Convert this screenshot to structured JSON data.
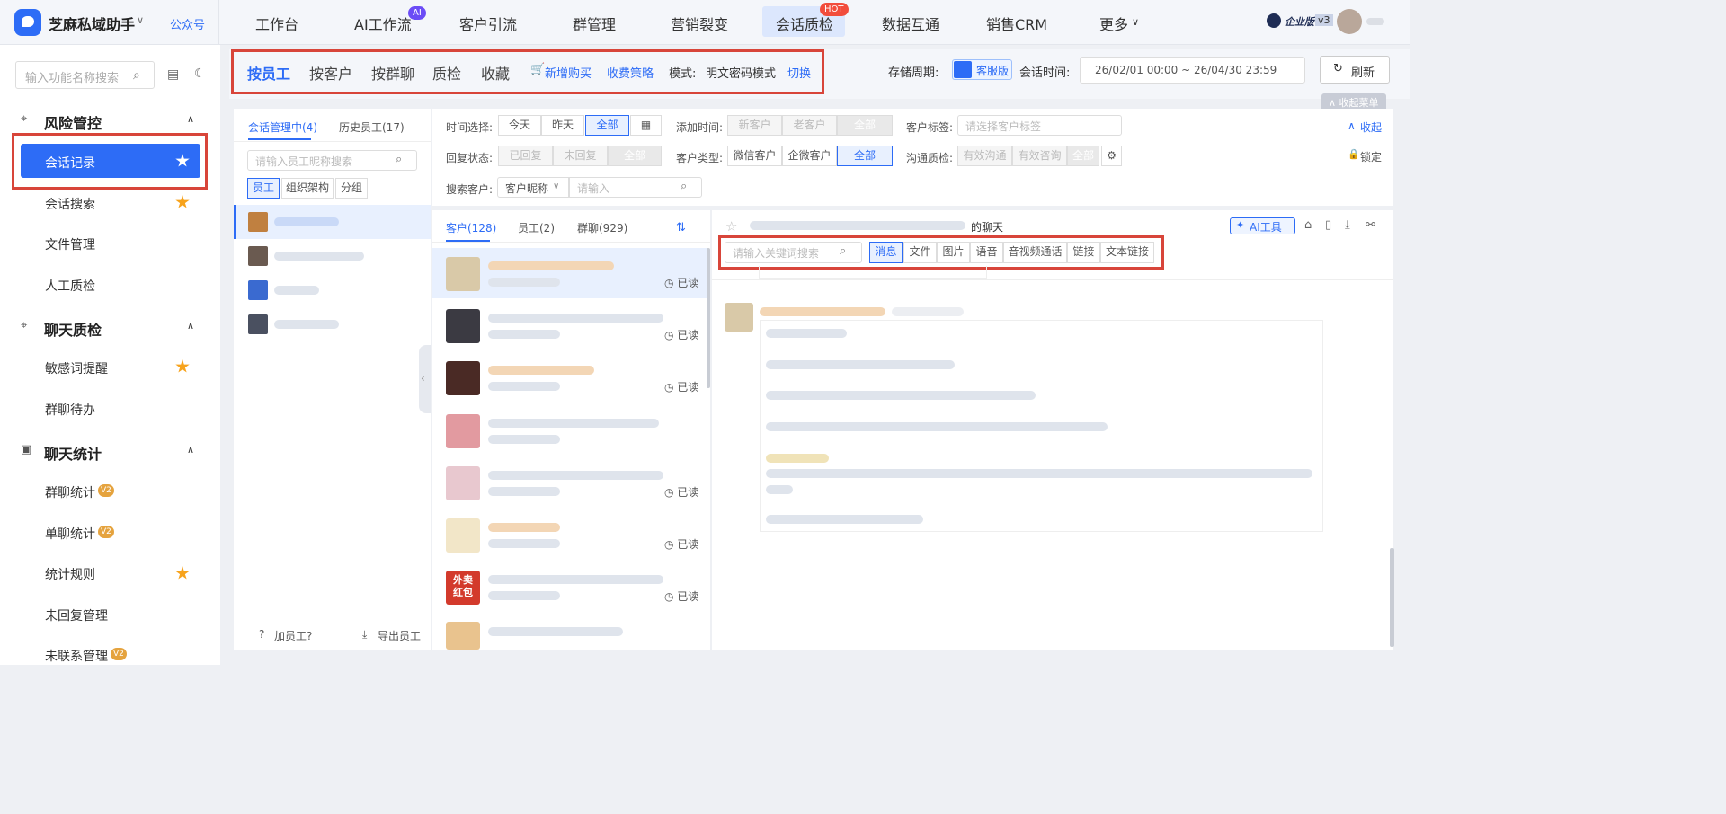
{
  "brand": "芝麻私域助手",
  "brand_link": "公众号",
  "nav": [
    "工作台",
    "AI工作流",
    "客户引流",
    "群管理",
    "营销裂变",
    "会话质检",
    "数据互通",
    "销售CRM",
    "更多"
  ],
  "nav_ai": "AI",
  "nav_hot": "HOT",
  "edition": "企业版",
  "version": "v3",
  "side_search": "输入功能名称搜索",
  "sections": [
    "风险管控",
    "聊天质检",
    "聊天统计"
  ],
  "items": [
    "会话记录",
    "会话搜索",
    "文件管理",
    "人工质检",
    "敏感词提醒",
    "群聊待办",
    "群聊统计",
    "单聊统计",
    "统计规则",
    "未回复管理",
    "未联系管理"
  ],
  "v2": "V2",
  "top_tabs": [
    "按员工",
    "按客户",
    "按群聊",
    "质检",
    "收藏"
  ],
  "buy": "新增购买",
  "strategy": "收费策略",
  "mode_label": "模式:",
  "mode_value": "明文密码模式",
  "switch": "切换",
  "storage": "存储周期:",
  "storage_chip": "客服版",
  "session_time": "会话时间:",
  "range": "26/02/01 00:00  ~  26/04/30 23:59",
  "refresh": "刷新",
  "collapse_menu": "∧ 收起菜单",
  "emp_tabs": [
    "会话管理中(4)",
    "历史员工(17)"
  ],
  "emp_search": "请输入员工昵称搜索",
  "emp_seg": [
    "员工",
    "组织架构",
    "分组"
  ],
  "add_emp": "加员工?",
  "export_emp": "导出员工",
  "f_time": "时间选择:",
  "f_time_opts": [
    "今天",
    "昨天",
    "全部"
  ],
  "f_add": "添加时间:",
  "f_add_opts": [
    "新客户",
    "老客户",
    "全部"
  ],
  "f_tag": "客户标签:",
  "f_tag_ph": "请选择客户标签",
  "f_reply": "回复状态:",
  "f_reply_opts": [
    "已回复",
    "未回复",
    "全部"
  ],
  "f_type": "客户类型:",
  "f_type_opts": [
    "微信客户",
    "企微客户",
    "全部"
  ],
  "f_qc": "沟通质检:",
  "f_qc_opts": [
    "有效沟通",
    "有效咨询",
    "全部"
  ],
  "f_search": "搜索客户:",
  "f_search_sel": "客户昵称",
  "f_search_ph": "请输入",
  "fold": "收起",
  "lock": "锁定",
  "cust_tabs": [
    "客户(128)",
    "员工(2)",
    "群聊(929)"
  ],
  "read": "已读",
  "chat_title_suffix": "的聊天",
  "ai_tool": "AI工具",
  "kw_ph": "请输入关键词搜索",
  "msg_types": [
    "消息",
    "文件",
    "图片",
    "语音",
    "音视频通话",
    "链接",
    "文本链接"
  ],
  "promo": [
    "外卖",
    "红包"
  ]
}
